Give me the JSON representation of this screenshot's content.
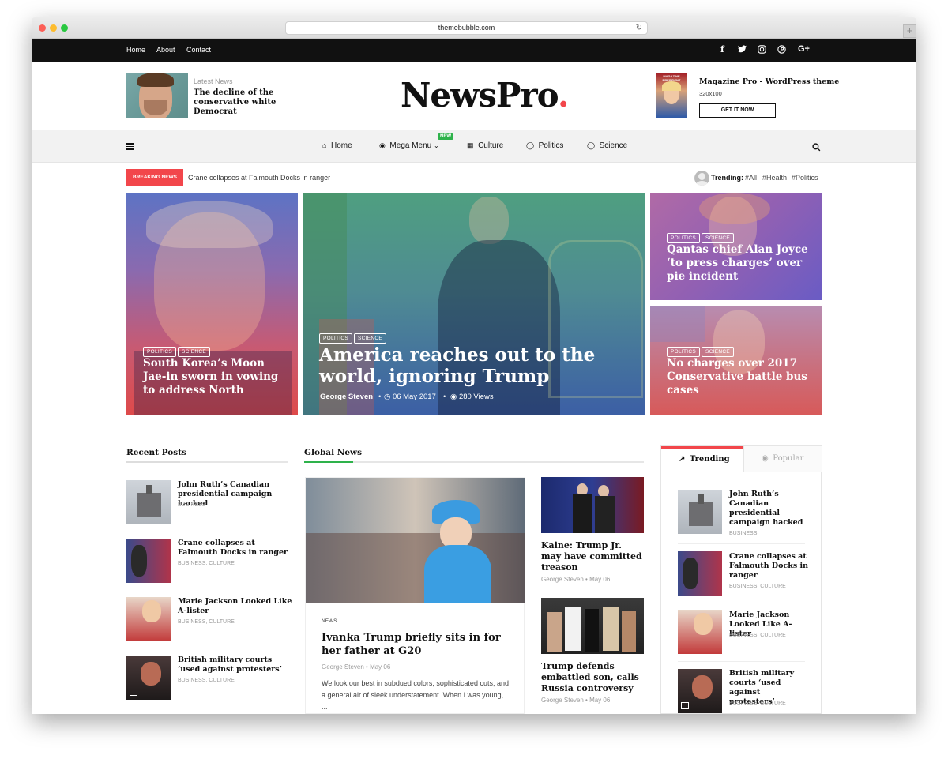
{
  "browser": {
    "url": "themebubble.com"
  },
  "topbar": {
    "links": [
      "Home",
      "About",
      "Contact"
    ],
    "social_icons": [
      "facebook-icon",
      "twitter-icon",
      "instagram-icon",
      "pinterest-icon",
      "google-plus-icon"
    ]
  },
  "header": {
    "latest_label": "Latest News",
    "latest_title": "The decline of the conservative white Democrat",
    "logo": "NewsPro",
    "ad_title": "Magazine Pro - WordPress theme",
    "ad_size": "320x100",
    "ad_button": "GET IT NOW",
    "ad_cover_text": "MAGAZINE PRESIDENT"
  },
  "nav": {
    "items": [
      "Home",
      "Mega Menu",
      "Culture",
      "Politics",
      "Science"
    ],
    "new_badge": "NEW",
    "colors": {
      "badge": "#2eb24b"
    }
  },
  "breaking": {
    "label": "BREAKING NEWS",
    "headline": "Crane collapses at Falmouth Docks in ranger",
    "trending_label": "Trending:",
    "trending_tags": [
      "#All",
      "#Health",
      "#Politics"
    ],
    "colors": {
      "label": "#f2464b"
    }
  },
  "hero": {
    "left": {
      "tags": [
        "POLITICS",
        "SCIENCE"
      ],
      "title": "South Korea’s Moon Jae-in sworn in vowing to address North"
    },
    "center": {
      "tags": [
        "POLITICS",
        "SCIENCE"
      ],
      "title": "America reaches out to the world, ignoring Trump",
      "author": "George Steven",
      "date": "06 May 2017",
      "views": "280 Views"
    },
    "right_top": {
      "tags": [
        "POLITICS",
        "SCIENCE"
      ],
      "title": "Qantas chief Alan Joyce ‘to press charges’ over pie incident"
    },
    "right_bottom": {
      "tags": [
        "POLITICS",
        "SCIENCE"
      ],
      "title": "No charges over 2017 Conservative battle bus cases"
    }
  },
  "recent_posts": {
    "title": "Recent Posts",
    "items": [
      {
        "title": "John Ruth’s Canadian presidential campaign hacked",
        "meta": "BUSINESS"
      },
      {
        "title": "Crane collapses at Falmouth Docks in ranger",
        "meta": "BUSINESS, CULTURE"
      },
      {
        "title": "Marie Jackson Looked Like A-lister",
        "meta": "BUSINESS, CULTURE"
      },
      {
        "title": "British military courts ‘used against protesters’",
        "meta": "BUSINESS, CULTURE"
      }
    ]
  },
  "global_news": {
    "title": "Global News",
    "main": {
      "category": "NEWS",
      "title": "Ivanka Trump briefly sits in for her father at G20",
      "author": "George Steven",
      "date": "May 06",
      "excerpt": "We look our best in subdued colors, sophisticated cuts, and a general air of sleek understatement. When I was young, ..."
    },
    "side": [
      {
        "title": "Kaine: Trump Jr. may have committed treason",
        "author": "George Steven",
        "date": "May 06"
      },
      {
        "title": "Trump defends embattled son, calls Russia controversy",
        "author": "George Steven",
        "date": "May 06"
      }
    ]
  },
  "tabs_widget": {
    "tabs": [
      "Trending",
      "Popular"
    ],
    "items": [
      {
        "title": "John Ruth’s Canadian presidential campaign hacked",
        "meta": "BUSINESS"
      },
      {
        "title": "Crane collapses at Falmouth Docks in ranger",
        "meta": "BUSINESS, CULTURE"
      },
      {
        "title": "Marie Jackson Looked Like A-lister",
        "meta": "BUSINESS, CULTURE"
      },
      {
        "title": "British military courts ‘used against protesters’",
        "meta": "BUSINESS, CULTURE"
      }
    ],
    "colors": {
      "accent": "#f2464b"
    }
  }
}
